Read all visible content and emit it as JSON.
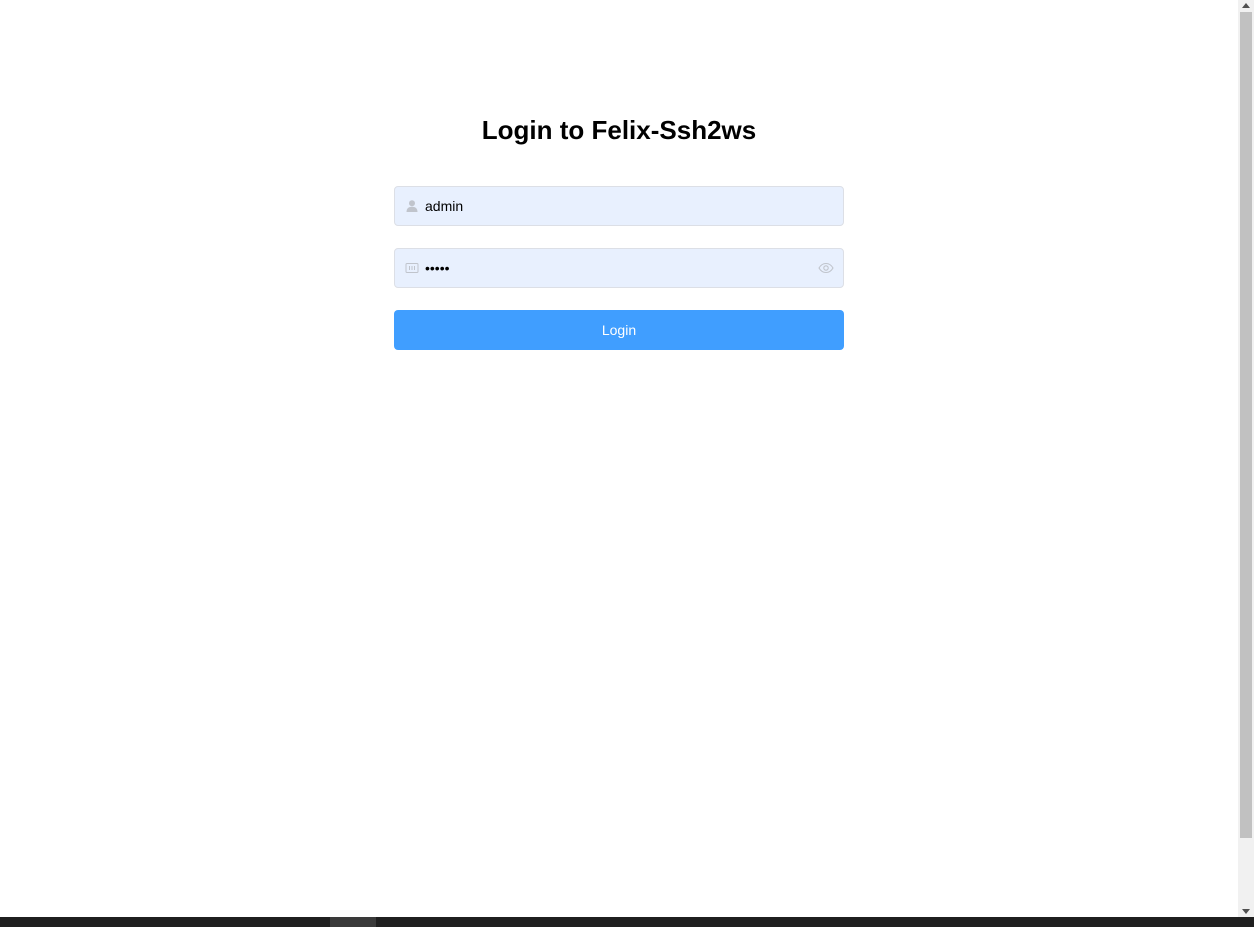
{
  "login": {
    "title": "Login to Felix-Ssh2ws",
    "username_value": "admin",
    "password_masked": "•••••",
    "submit_label": "Login"
  },
  "icons": {
    "username_prefix": "user-icon",
    "password_prefix": "lock-icon",
    "password_suffix": "eye-icon"
  },
  "colors": {
    "accent": "#409eff",
    "autofill_bg": "#e8f0fe",
    "icon_gray": "#c0c4cc"
  }
}
